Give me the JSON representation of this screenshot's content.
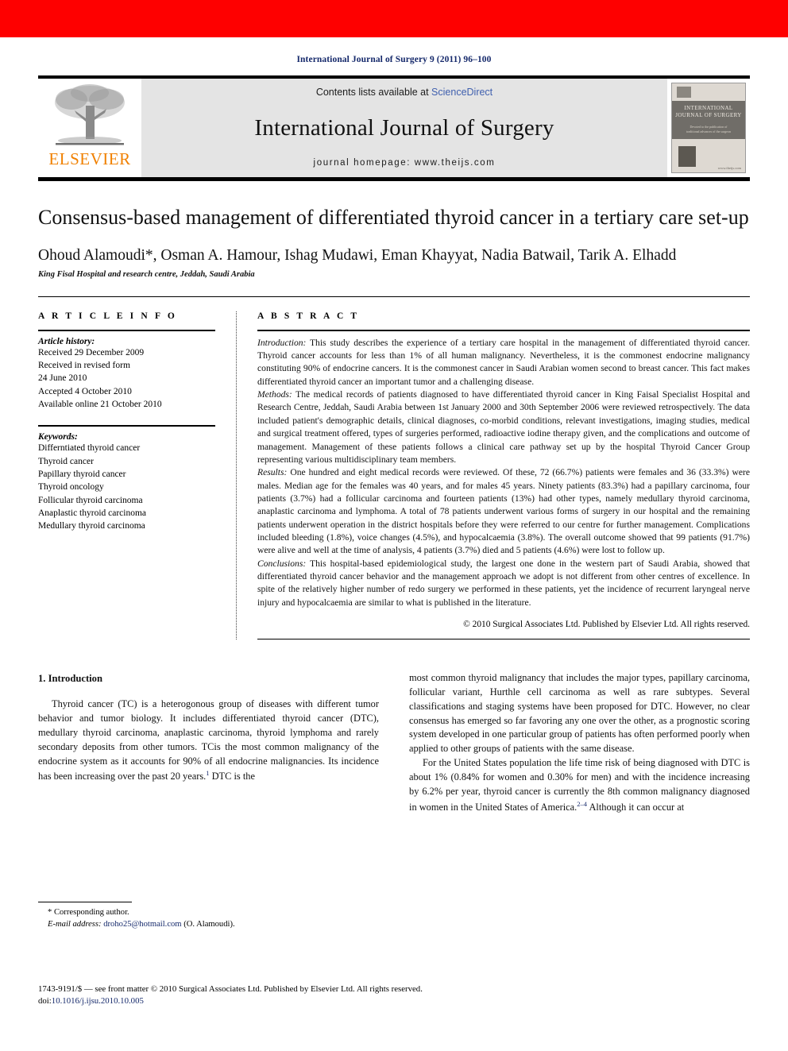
{
  "top_band": {
    "color": "#fe0000"
  },
  "journal_ref": "International Journal of Surgery 9 (2011) 96–100",
  "masthead": {
    "publisher_logo_label": "ELSEVIER",
    "contents_prefix": "Contents lists available at ",
    "contents_link": "ScienceDirect",
    "journal_title": "International Journal of Surgery",
    "homepage": "journal homepage: www.theijs.com",
    "cover": {
      "title_line_1": "INTERNATIONAL",
      "title_line_2": "JOURNAL OF SURGERY",
      "subtitle_line_1": "Devoted to the publication of",
      "subtitle_line_2": "traditional advances of the surgeon",
      "url": "www.theijs.com"
    },
    "link_color": "#3f5fae",
    "elsevier_color": "#f08000"
  },
  "article": {
    "title": "Consensus-based management of differentiated thyroid cancer in a tertiary care set-up",
    "authors": "Ohoud Alamoudi*, Osman A. Hamour, Ishag Mudawi, Eman Khayyat, Nadia Batwail, Tarik A. Elhadd",
    "affiliation": "King Fisal Hospital and research centre, Jeddah, Saudi Arabia"
  },
  "article_info": {
    "heading": "A R T I C L E   I N F O",
    "history_label": "Article history:",
    "history": [
      "Received 29 December 2009",
      "Received in revised form",
      "24 June 2010",
      "Accepted 4 October 2010",
      "Available online 21 October 2010"
    ],
    "keywords_label": "Keywords:",
    "keywords": [
      "Differntiated thyroid cancer",
      "Thyroid cancer",
      "Papillary thyroid cancer",
      "Thyroid oncology",
      "Follicular thyroid carcinoma",
      "Anaplastic thyroid carcinoma",
      "Medullary thyroid carcinoma"
    ]
  },
  "abstract": {
    "heading": "A B S T R A C T",
    "sections": [
      {
        "label": "Introduction:",
        "text": " This study describes the experience of a tertiary care hospital in the management of differentiated thyroid cancer. Thyroid cancer accounts for less than 1% of all human malignancy. Nevertheless, it is the commonest endocrine malignancy constituting 90% of endocrine cancers. It is the commonest cancer in Saudi Arabian women second to breast cancer. This fact makes differentiated thyroid cancer an important tumor and a challenging disease."
      },
      {
        "label": "Methods:",
        "text": " The medical records of patients diagnosed to have differentiated thyroid cancer in King Faisal Specialist Hospital and Research Centre, Jeddah, Saudi Arabia between 1st January 2000 and 30th September 2006 were reviewed retrospectively. The data included patient's demographic details, clinical diagnoses, co-morbid conditions, relevant investigations, imaging studies, medical and surgical treatment offered, types of surgeries performed, radioactive iodine therapy given, and the complications and outcome of management. Management of these patients follows a clinical care pathway set up by the hospital Thyroid Cancer Group representing various multidisciplinary team members."
      },
      {
        "label": "Results:",
        "text": " One hundred and eight medical records were reviewed. Of these, 72 (66.7%) patients were females and 36 (33.3%) were males. Median age for the females was 40 years, and for males 45 years. Ninety patients (83.3%) had a papillary carcinoma, four patients (3.7%) had a follicular carcinoma and fourteen patients (13%) had other types, namely medullary thyroid carcinoma, anaplastic carcinoma and lymphoma. A total of 78 patients underwent various forms of surgery in our hospital and the remaining patients underwent operation in the district hospitals before they were referred to our centre for further management. Complications included bleeding (1.8%), voice changes (4.5%), and hypocalcaemia (3.8%). The overall outcome showed that 99 patients (91.7%) were alive and well at the time of analysis, 4 patients (3.7%) died and 5 patients (4.6%) were lost to follow up."
      },
      {
        "label": "Conclusions:",
        "text": " This hospital-based epidemiological study, the largest one done in the western part of Saudi Arabia, showed that differentiated thyroid cancer behavior and the management approach we adopt is not different from other centres of excellence. In spite of the relatively higher number of redo surgery we performed in these patients, yet the incidence of recurrent laryngeal nerve injury and hypocalcaemia are similar to what is published in the literature."
      }
    ],
    "copyright": "© 2010 Surgical Associates Ltd. Published by Elsevier Ltd. All rights reserved."
  },
  "body": {
    "section_heading": "1. Introduction",
    "left_paragraph_1_a": "Thyroid cancer (TC) is a heterogonous group of diseases with different tumor behavior and tumor biology. It includes differentiated thyroid cancer (DTC), medullary thyroid carcinoma, anaplastic carcinoma, thyroid lymphoma and rarely secondary deposits from other tumors. TCis the most common malignancy of the endocrine system as it accounts for 90% of all endocrine malignancies. Its incidence has been increasing over the past 20 years.",
    "left_paragraph_1_ref": "1",
    "left_paragraph_1_b": " DTC is the",
    "right_paragraph_1_cont": "most common thyroid malignancy that includes the major types, papillary carcinoma, follicular variant, Hurthle cell carcinoma as well as rare subtypes. Several classifications and staging systems have been proposed for DTC. However, no clear consensus has emerged so far favoring any one over the other, as a prognostic scoring system developed in one particular group of patients has often performed poorly when applied to other groups of patients with the same disease.",
    "right_paragraph_2_a": "For the United States population the life time risk of being diagnosed with DTC is about 1% (0.84% for women and 0.30% for men) and with the incidence increasing by 6.2% per year, thyroid cancer is currently the 8th common malignancy diagnosed in women in the United States of America.",
    "right_paragraph_2_ref": "2–4",
    "right_paragraph_2_b": " Although it can occur at"
  },
  "footnote": {
    "corresponding": "* Corresponding author.",
    "email_label": "E-mail address:",
    "email": "droho25@hotmail.com",
    "email_suffix": " (O. Alamoudi)."
  },
  "page_footer": {
    "issn_line": "1743-9191/$ — see front matter © 2010 Surgical Associates Ltd. Published by Elsevier Ltd. All rights reserved.",
    "doi_label": "doi:",
    "doi_value": "10.1016/j.ijsu.2010.10.005"
  }
}
